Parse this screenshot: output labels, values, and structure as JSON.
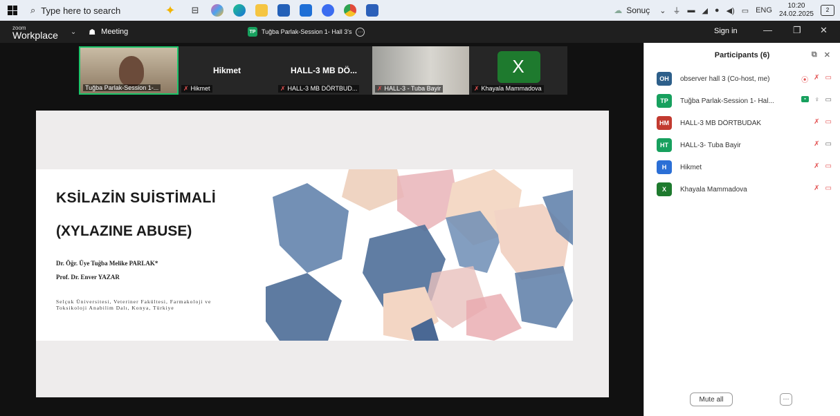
{
  "taskbar": {
    "search_placeholder": "Type here to search",
    "weather": "Sonuç",
    "lang": "ENG",
    "time": "10:20",
    "date": "24.02.2025",
    "notifications": "2"
  },
  "zoom": {
    "logo_small": "zoom",
    "logo_big": "Workplace",
    "meeting_label": "Meeting",
    "session_initials": "TP",
    "session_title": "Tuğba Parlak-Session 1- Hall 3's ",
    "sign_in": "Sign in"
  },
  "thumbnails": [
    {
      "name": "Tuğba Parlak-Session 1-...",
      "big": ""
    },
    {
      "name": "Hikmet",
      "big": "Hikmet"
    },
    {
      "name": "HALL-3 MB DÖRTBUD...",
      "big": "HALL-3 MB DÖ..."
    },
    {
      "name": "HALL-3 - Tuba Bayir",
      "big": ""
    },
    {
      "name": "Khayala Mammadova",
      "big": "X"
    }
  ],
  "slide": {
    "title": "KSİLAZİN SUİSTİMALİ",
    "subtitle": "(XYLAZINE ABUSE)",
    "author1": "Dr. Öğr. Üye Tuğba Melike PARLAK*",
    "author2": "Prof. Dr. Enver YAZAR",
    "affiliation": "Selçuk Üniversitesi, Veteriner Fakültesi, Farmakoloji ve Toksikoloji Anabilim Dalı, Konya, Türkiye"
  },
  "participants": {
    "header": "Participants (6)",
    "items": [
      {
        "initials": "OH",
        "name": "observer hall 3 (Co-host, me)",
        "color": "#2d5f8a"
      },
      {
        "initials": "TP",
        "name": "Tuğba Parlak-Session 1- Hal...",
        "color": "#17a05e"
      },
      {
        "initials": "HM",
        "name": "HALL-3 MB DÖRTBUDAK",
        "color": "#c23a30"
      },
      {
        "initials": "HT",
        "name": "HALL-3- Tuba Bayir",
        "color": "#17a05e"
      },
      {
        "initials": "H",
        "name": "Hikmet",
        "color": "#2b6fd6"
      },
      {
        "initials": "X",
        "name": "Khayala Mammadova",
        "color": "#1e7a2e"
      }
    ],
    "mute_all": "Mute all",
    "more": "···"
  }
}
